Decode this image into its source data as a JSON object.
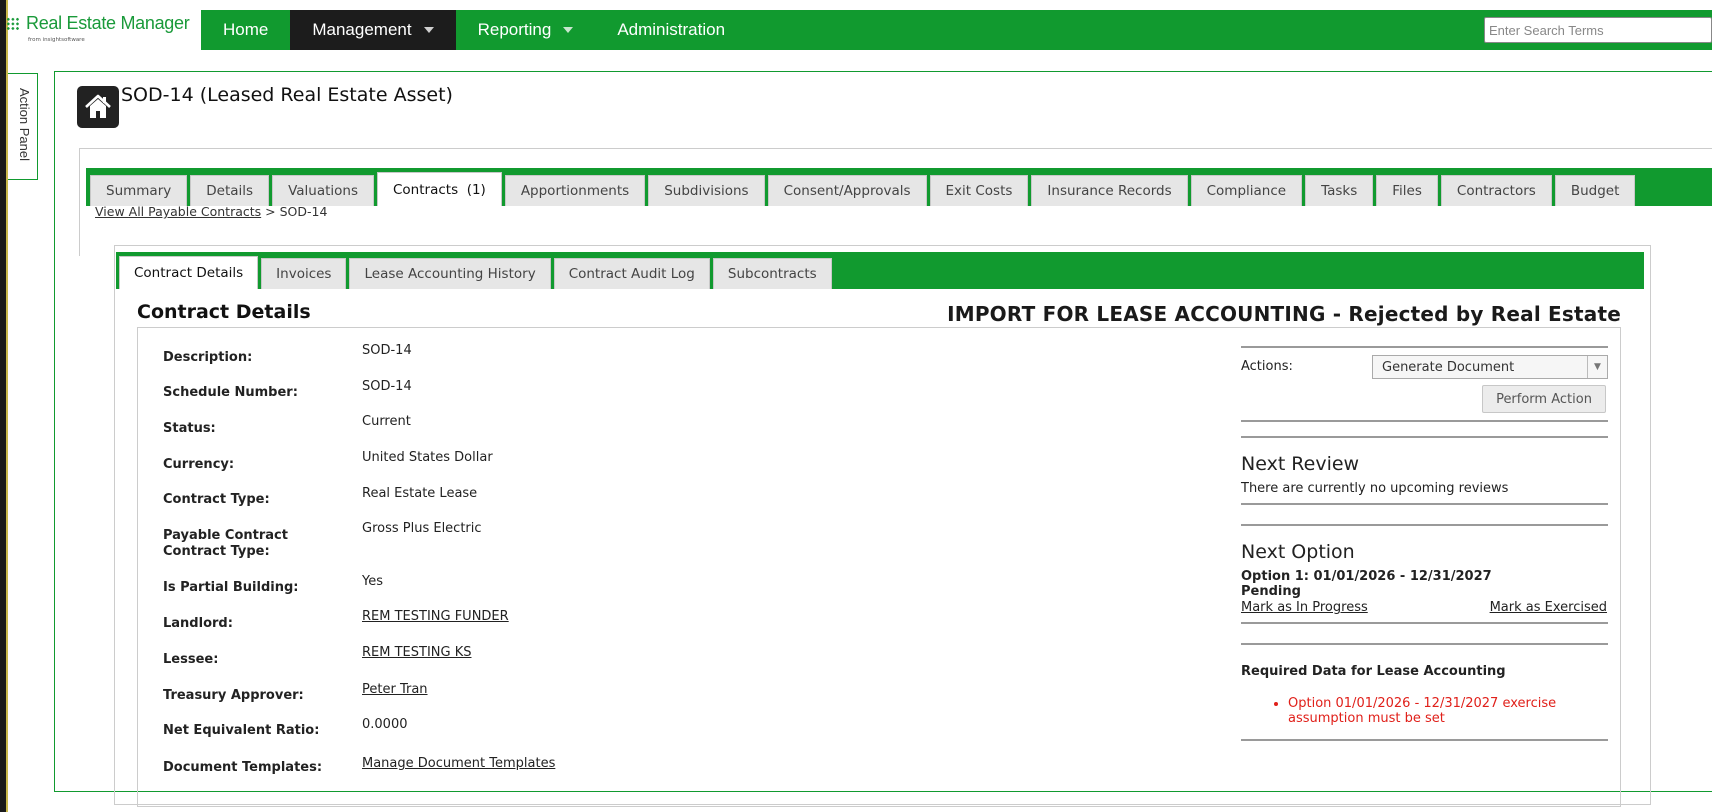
{
  "app": {
    "logo_text": "Real Estate Manager",
    "logo_sub": "from insightsoftware",
    "brand_color": "#119a2f"
  },
  "topnav": {
    "items": [
      {
        "label": "Home",
        "active": false,
        "dropdown": false
      },
      {
        "label": "Management",
        "active": true,
        "dropdown": true
      },
      {
        "label": "Reporting",
        "active": false,
        "dropdown": true
      },
      {
        "label": "Administration",
        "active": false,
        "dropdown": false
      }
    ],
    "search_placeholder": "Enter Search Terms"
  },
  "action_panel": {
    "label": "Action Panel"
  },
  "asset": {
    "icon": "house-icon",
    "title": "SOD-14 (Leased Real Estate Asset)"
  },
  "tabs": [
    {
      "label": "Summary"
    },
    {
      "label": "Details"
    },
    {
      "label": "Valuations"
    },
    {
      "label": "Contracts  (1)",
      "active": true
    },
    {
      "label": "Apportionments"
    },
    {
      "label": "Subdivisions"
    },
    {
      "label": "Consent/Approvals"
    },
    {
      "label": "Exit Costs"
    },
    {
      "label": "Insurance Records"
    },
    {
      "label": "Compliance"
    },
    {
      "label": "Tasks"
    },
    {
      "label": "Files"
    },
    {
      "label": "Contractors"
    },
    {
      "label": "Budget"
    }
  ],
  "breadcrumb": {
    "link": "View All Payable Contracts",
    "separator": ">",
    "current": "SOD-14"
  },
  "subtabs": [
    {
      "label": "Contract Details",
      "active": true
    },
    {
      "label": "Invoices"
    },
    {
      "label": "Lease Accounting History"
    },
    {
      "label": "Contract Audit Log"
    },
    {
      "label": "Subcontracts"
    }
  ],
  "contract": {
    "section_title": "Contract Details",
    "import_status": "IMPORT FOR LEASE ACCOUNTING - Rejected by Real Estate",
    "fields": {
      "description_label": "Description:",
      "description": "SOD-14",
      "schedule_label": "Schedule Number:",
      "schedule": "SOD-14",
      "status_label": "Status:",
      "status": "Current",
      "currency_label": "Currency:",
      "currency": "United States Dollar",
      "contract_type_label": "Contract Type:",
      "contract_type": "Real Estate Lease",
      "payable_type_label": "Payable Contract Contract Type:",
      "payable_type": "Gross Plus Electric",
      "partial_label": "Is Partial Building:",
      "partial": "Yes",
      "landlord_label": "Landlord:",
      "landlord": "REM TESTING FUNDER",
      "lessee_label": "Lessee:",
      "lessee": "REM TESTING KS",
      "treasury_label": "Treasury Approver:",
      "treasury": "Peter Tran",
      "ratio_label": "Net Equivalent Ratio:",
      "ratio": "0.0000",
      "templates_label": "Document Templates:",
      "templates": "Manage Document Templates"
    }
  },
  "side": {
    "actions_label": "Actions:",
    "actions_selected": "Generate Document",
    "perform_button": "Perform Action",
    "next_review_title": "Next Review",
    "next_review_text": "There are currently no upcoming reviews",
    "next_option_title": "Next Option",
    "option_line": "Option 1: 01/01/2026 - 12/31/2027",
    "option_status": "Pending",
    "mark_in_progress": "Mark as In Progress",
    "mark_exercised": "Mark as Exercised",
    "required_title": "Required Data for Lease Accounting",
    "required_items": [
      "Option 01/01/2026 - 12/31/2027 exercise assumption must be set"
    ],
    "error_color": "#e0201a"
  }
}
